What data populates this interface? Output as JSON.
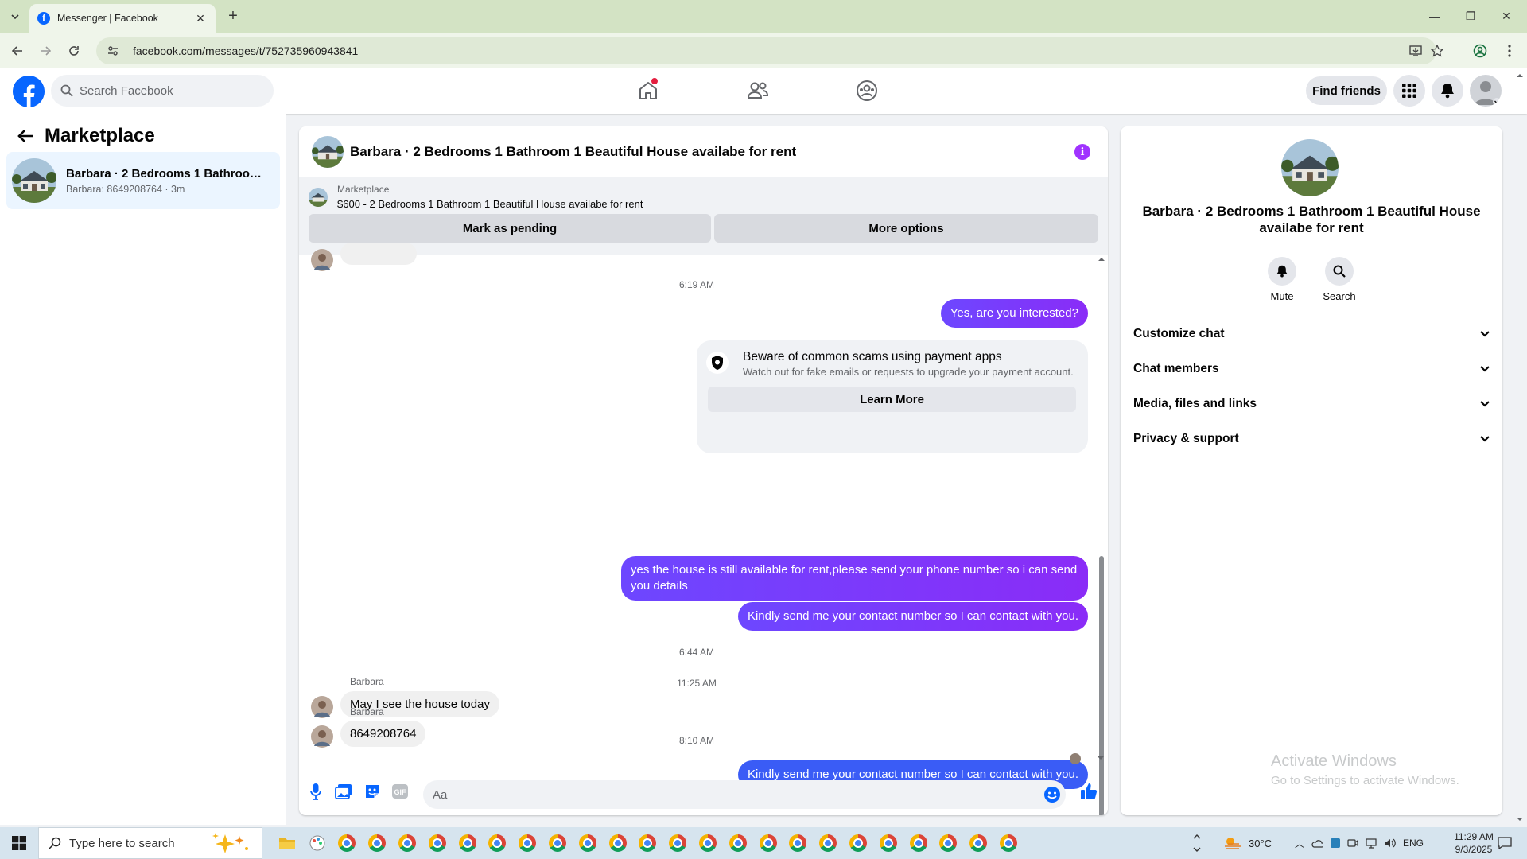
{
  "browser": {
    "tab_title": "Messenger | Facebook",
    "url": "facebook.com/messages/t/752735960943841"
  },
  "fb_header": {
    "search_placeholder": "Search Facebook",
    "find_friends": "Find friends"
  },
  "sidebar": {
    "title": "Marketplace",
    "conversation": {
      "title": "Barbara · 2 Bedrooms 1 Bathroom ...",
      "subtitle": "Barbara: 8649208764 · 3m"
    }
  },
  "chat": {
    "title": "Barbara · 2 Bedrooms 1 Bathroom 1 Beautiful House availabe for rent",
    "listing_source": "Marketplace",
    "listing_text": "$600 - 2 Bedrooms 1 Bathroom 1 Beautiful House availabe for rent",
    "mark_pending": "Mark as pending",
    "more_options": "More options",
    "messages": {
      "ts1": "6:19 AM",
      "out1": "Yes, are you interested?",
      "scam_title": "Beware of common scams using payment apps",
      "scam_body": "Watch out for fake emails or requests to upgrade your payment account.",
      "learn_more": "Learn More",
      "out2_line1": "yes the house is still available for rent,please send your  phone number so i can send",
      "out2_line2": "you details",
      "out3": "Kindly send me your contact number so I can contact with you.",
      "ts2": "6:44 AM",
      "sender1": "Barbara",
      "in1": "May I see the house today",
      "ts3": "8:10 AM",
      "out4": "Kindly send me your contact number so I can contact with you.",
      "ts4": "11:25 AM",
      "sender2": "Barbara",
      "in2": "8649208764"
    },
    "composer_placeholder": "Aa"
  },
  "right_panel": {
    "title": "Barbara · 2 Bedrooms 1 Bathroom 1 Beautiful House availabe for rent",
    "mute": "Mute",
    "search": "Search",
    "rows": [
      "Customize chat",
      "Chat members",
      "Media, files and links",
      "Privacy & support"
    ]
  },
  "watermark": {
    "line1": "Activate Windows",
    "line2": "Go to Settings to activate Windows."
  },
  "taskbar": {
    "search_placeholder": "Type here to search",
    "temperature": "30°C",
    "language": "ENG",
    "time": "11:29 AM",
    "date": "9/3/2025"
  },
  "colors": {
    "fb_blue": "#0866ff",
    "bubble_purple": "#7a44ff",
    "bubble_blue": "#3a5cf6",
    "info_purple": "#a033ff"
  }
}
